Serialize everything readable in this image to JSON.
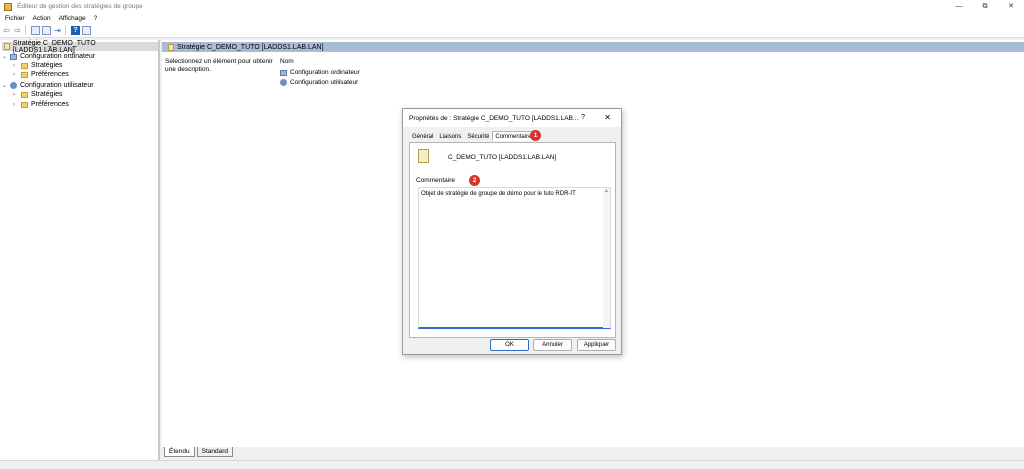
{
  "window": {
    "title": "Éditeur de gestion des stratégies de groupe",
    "controls": [
      "—",
      "⧉",
      "✕"
    ]
  },
  "menu": [
    "Fichier",
    "Action",
    "Affichage",
    "?"
  ],
  "tree": {
    "root": "Stratégie C_DEMO_TUTO [LADDS1.LAB.LAN]",
    "computer_config": "Configuration ordinateur",
    "computer_strategies": "Stratégies",
    "computer_preferences": "Préférences",
    "user_config": "Configuration utilisateur",
    "user_strategies": "Stratégies",
    "user_preferences": "Préférences"
  },
  "right_pane": {
    "header": "Stratégie C_DEMO_TUTO [LADDS1.LAB.LAN]",
    "description": "Sélectionnez un élément pour obtenir une description.",
    "column_name": "Nom",
    "items": [
      "Configuration ordinateur",
      "Configuration utilisateur"
    ]
  },
  "bottom_tabs": [
    "Étendu",
    "Standard"
  ],
  "dialog": {
    "title": "Propriétés de : Stratégie C_DEMO_TUTO [LADDS1.LAB...",
    "help": "?",
    "close": "✕",
    "tabs": [
      "Général",
      "Liaisons",
      "Sécurité",
      "Commentaire"
    ],
    "active_tab": "Commentaire",
    "gpo_name": "C_DEMO_TUTO [LADDS1.LAB.LAN]",
    "comment_label": "Commentaire",
    "comment_text": "Objet de stratégie de groupe de démo pour le tuto RDR-IT",
    "buttons": {
      "ok": "OK",
      "cancel": "Annuler",
      "apply": "Appliquer"
    },
    "badges": {
      "tab": "1",
      "comment": "2"
    }
  },
  "colors": {
    "accent": "#2e6cc7",
    "badge": "#d9342b",
    "header_bar": "#a9bcd6"
  }
}
